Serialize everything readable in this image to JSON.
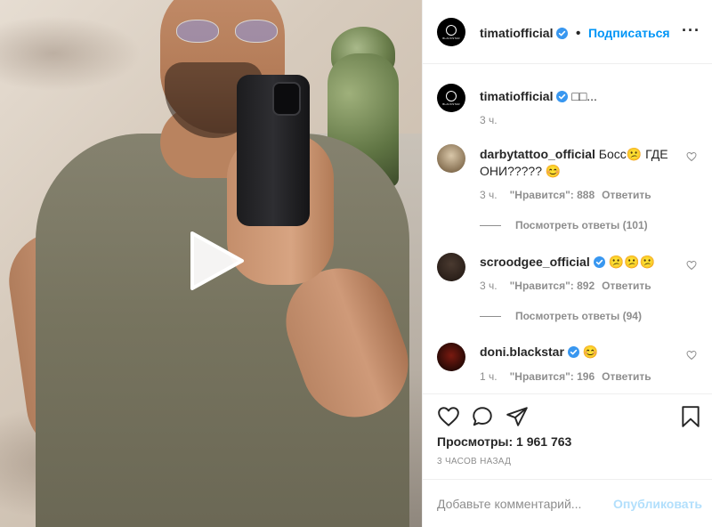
{
  "post": {
    "author": "timatiofficial",
    "follow_label": "Подписаться",
    "more_icon": "more-dots-icon",
    "avatar_text": "BLACKSTAR"
  },
  "caption": {
    "username": "timatiofficial",
    "text": "□□...",
    "time": "3 ч."
  },
  "comments": [
    {
      "username": "darbytattoo_official",
      "text": "Босс😕 ГДЕ ОНИ????? 😊",
      "time": "3 ч.",
      "likes": "\"Нравится\": 888",
      "reply": "Ответить",
      "view_replies": "Посмотреть ответы (101)"
    },
    {
      "username": "scroodgee_official",
      "text": "😕😕😕",
      "time": "3 ч.",
      "likes": "\"Нравится\": 892",
      "reply": "Ответить",
      "view_replies": "Посмотреть ответы (94)"
    },
    {
      "username": "doni.blackstar",
      "text": "😊",
      "time": "1 ч.",
      "likes": "\"Нравится\": 196",
      "reply": "Ответить"
    }
  ],
  "actions": {
    "icons": [
      "heart-icon",
      "comment-icon",
      "share-icon",
      "bookmark-icon"
    ],
    "views": "Просмотры: 1 961 763",
    "time_ago": "3 ЧАСОВ НАЗАД"
  },
  "comment_box": {
    "placeholder": "Добавьте комментарий...",
    "publish_label": "Опубликовать"
  },
  "colors": {
    "accent": "#0095f6",
    "verified": "#3897f0",
    "publish_disabled": "#b2dffc",
    "muted": "#8e8e8e"
  }
}
